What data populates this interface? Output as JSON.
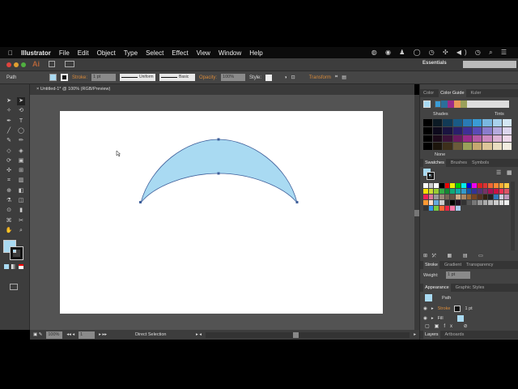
{
  "menubar": {
    "app": "Illustrator",
    "items": [
      "File",
      "Edit",
      "Object",
      "Type",
      "Select",
      "Effect",
      "View",
      "Window",
      "Help"
    ]
  },
  "appbar": {
    "logo": "Ai",
    "workspace": "Essentials",
    "search_placeholder": ""
  },
  "control": {
    "selection": "Path",
    "stroke_label": "Stroke:",
    "stroke_weight": "1 pt",
    "profile": "Uniform",
    "brush": "Basic",
    "opacity_label": "Opacity:",
    "opacity": "100%",
    "style_label": "Style:",
    "transform": "Transform"
  },
  "document": {
    "tab": "Untitled-1* @ 100% (RGB/Preview)"
  },
  "colors": {
    "fill": "#a9daf2",
    "accent": "#d98a3a"
  },
  "color_guide": {
    "tabs": [
      "Color",
      "Color Guide",
      "Kuler"
    ],
    "shades": "Shades",
    "tints": "Tints",
    "none": "None"
  },
  "swatches": {
    "tabs": [
      "Swatches",
      "Brushes",
      "Symbols"
    ]
  },
  "stroke_panel": {
    "tabs": [
      "Stroke",
      "Gradient",
      "Transparency"
    ],
    "weight_label": "Weight:",
    "weight": "1 pt"
  },
  "appearance": {
    "tabs": [
      "Appearance",
      "Graphic Styles"
    ],
    "object": "Path",
    "rows": [
      {
        "label": "Stroke",
        "value": "1 pt"
      },
      {
        "label": "Fill",
        "value": ""
      }
    ]
  },
  "layers": {
    "tabs": [
      "Layers",
      "Artboards"
    ]
  },
  "status": {
    "zoom": "100%",
    "artboard": "1",
    "tool": "Direct Selection"
  }
}
